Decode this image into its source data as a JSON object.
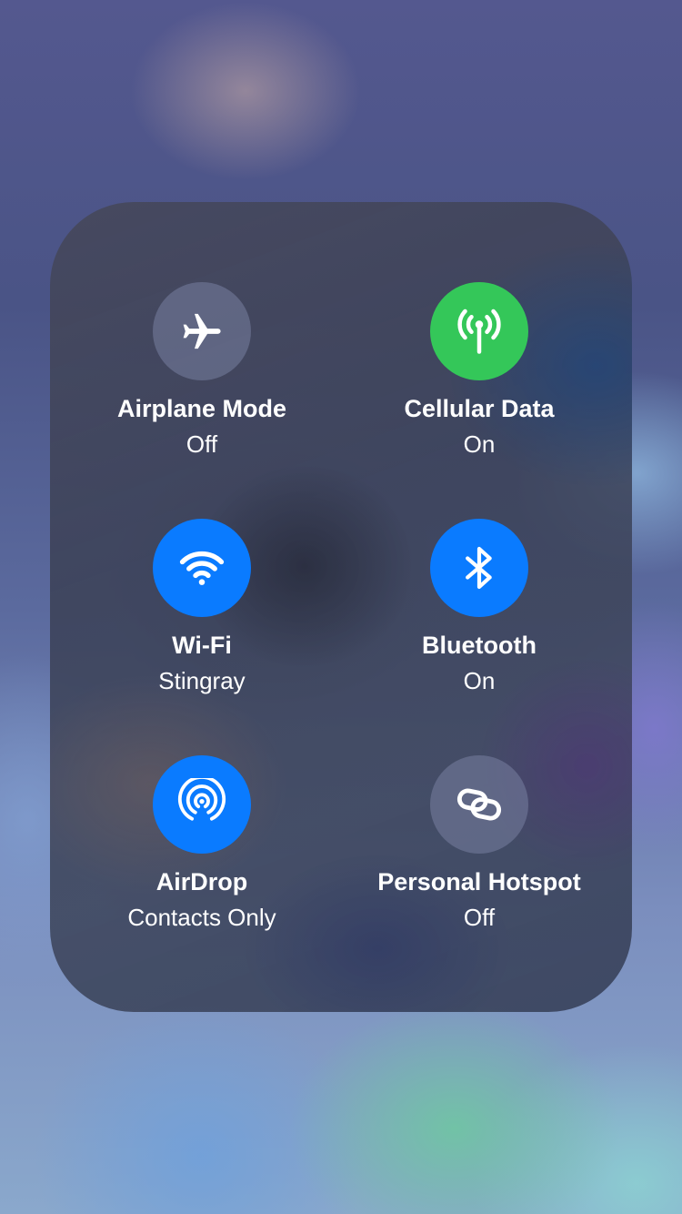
{
  "connectivity": {
    "airplane_mode": {
      "label": "Airplane Mode",
      "status": "Off",
      "icon": "airplane-icon",
      "state": "off",
      "color": "#7c82a6"
    },
    "cellular_data": {
      "label": "Cellular Data",
      "status": "On",
      "icon": "antenna-icon",
      "state": "on",
      "color": "#34c759"
    },
    "wifi": {
      "label": "Wi-Fi",
      "status": "Stingray",
      "icon": "wifi-icon",
      "state": "on",
      "color": "#0a7bff"
    },
    "bluetooth": {
      "label": "Bluetooth",
      "status": "On",
      "icon": "bluetooth-icon",
      "state": "on",
      "color": "#0a7bff"
    },
    "airdrop": {
      "label": "AirDrop",
      "status": "Contacts Only",
      "icon": "airdrop-icon",
      "state": "on",
      "color": "#0a7bff"
    },
    "personal_hotspot": {
      "label": "Personal Hotspot",
      "status": "Off",
      "icon": "hotspot-link-icon",
      "state": "off",
      "color": "#7c82a6"
    }
  }
}
